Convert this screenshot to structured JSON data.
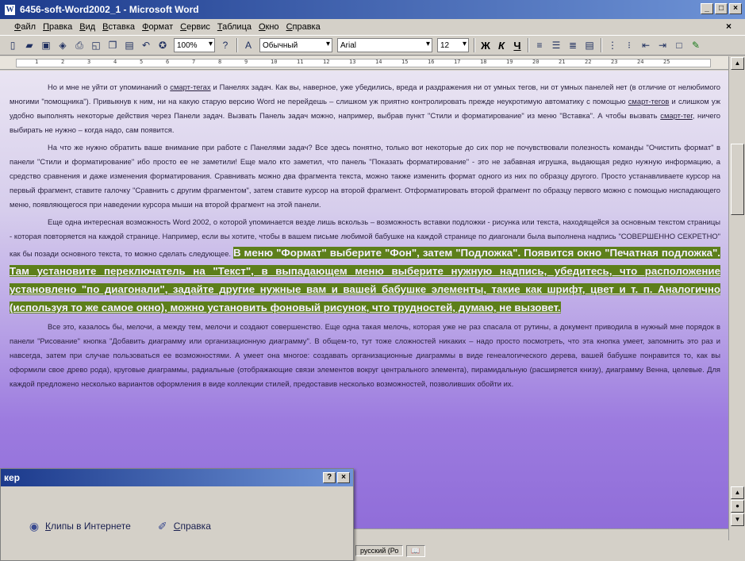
{
  "window": {
    "title": "6456-soft-Word2002_1 - Microsoft Word",
    "caption_buttons": [
      "_",
      "□",
      "×"
    ]
  },
  "menubar": {
    "items": [
      "Файл",
      "Правка",
      "Вид",
      "Вставка",
      "Формат",
      "Сервис",
      "Таблица",
      "Окно",
      "Справка"
    ],
    "close_doc": "×"
  },
  "toolbar": {
    "zoom": "100%",
    "style": "Обычный",
    "font": "Arial",
    "size": "12",
    "bold": "Ж",
    "italic": "К",
    "underline": "Ч"
  },
  "ruler": {
    "ticks": [
      "1",
      "2",
      "3",
      "4",
      "5",
      "6",
      "7",
      "8",
      "9",
      "10",
      "11",
      "12",
      "13",
      "14",
      "15",
      "16",
      "17",
      "18",
      "19",
      "20",
      "21",
      "22",
      "23",
      "24",
      "25"
    ]
  },
  "document": {
    "p1_a": "Но и мне не уйти от упоминаний о ",
    "p1_smart1": "смарт-тегах",
    "p1_b": " и Панелях задач. Как вы, наверное, уже убедились, вреда и раздражения ни от умных тегов, ни от умных панелей нет (в отличие от нелюбимого многими \"помощника\"). Привыкнув к ним, ни на какую старую версию Word не перейдешь – слишком уж приятно контролировать прежде неукротимую автоматику с помощью ",
    "p1_smart2": "смарт-тегов",
    "p1_c": " и слишком уж удобно выполнять некоторые действия через Панели задач. Вызвать Панель задач можно, например, выбрав пункт \"Стили и форматирование\" из меню \"Вставка\". А чтобы вызвать ",
    "p1_smart3": "смарт-тег",
    "p1_d": ", ничего выбирать не нужно – когда надо, сам появится.",
    "p2": "На что же нужно обратить ваше внимание при работе с Панелями задач? Все здесь понятно, только вот некоторые до сих пор не почувствовали полезность команды \"Очистить формат\" в панели \"Стили и форматирование\" ибо просто ее не заметили! Еще мало кто заметил, что панель \"Показать форматирование\" - это не забавная игрушка, выдающая редко нужную информацию, а средство сравнения и даже изменения форматирования. Сравнивать можно два фрагмента текста, можно также изменить формат одного из них по образцу другого. Просто устанавливаете курсор на первый фрагмент, ставите галочку \"Сравнить с другим фрагментом\", затем ставите курсор на второй фрагмент. Отформатировать второй фрагмент по образцу первого можно с помощью ниспадающего меню, появляющегося при наведении курсора мыши на второй фрагмент на этой панели.",
    "p3_a": "Еще одна интересная возможность Word 2002, о которой упоминается везде лишь вскользь – возможность вставки подложки - рисунка или текста, находящейся за основным текстом страницы - которая повторяется на каждой странице. Например, если вы хотите, чтобы в вашем письме любимой бабушке на каждой странице по диагонали была выполнена надпись \"СОВЕРШЕННО СЕКРЕТНО\" как бы позади основного текста, то можно сделать следующее. ",
    "p3_hl1": "В меню \"Формат\" выберите \"Фон\", затем \"Подложка\". Появится окно \"Печатная подложка\". ",
    "p3_hl2": "Там установите переключатель на \"Текст\", в выпадающем меню выберите нужную надпись, убедитесь, что расположение установлено \"по диагонали\", задайте другие нужные вам и вашей бабушке элементы, такие как шрифт, цвет и т. п. Аналогично (используя то же самое окно), можно установить фоновый рисунок, что трудностей, думаю, не вызовет.",
    "p4": "Все это, казалось бы, мелочи, а между тем, мелочи и создают совершенство. Еще одна такая мелочь, которая уже не раз спасала от рутины, а документ приводила в нужный мне порядок в панели \"Рисование\" кнопка \"Добавить диаграмму или организационную диаграмму\". В общем-то, тут тоже сложностей никаких – надо просто посмотреть, что эта кнопка умеет, запомнить это раз и навсегда, затем при случае пользоваться ее возможностями. А умеет она многое: создавать организационные диаграммы в виде генеалогического дерева, вашей бабушке понравится то, как вы оформили свое древо рода), круговые диаграммы, радиальные (отображающие связи элементов вокруг центрального элемента), пирамидальную (расширяется книзу), диаграмму Венна, целевые. Для каждой предложено несколько вариантов оформления в виде коллекции стилей, предоставив несколько возможностей, позволивших обойти их."
  },
  "taskpane": {
    "title": "кер",
    "help_btn": "?",
    "close_btn": "×",
    "link1": "Клипы в Интернете",
    "link2": "Справка"
  },
  "statusbar": {
    "lang": "русский (Ро",
    "icon": "📖"
  }
}
